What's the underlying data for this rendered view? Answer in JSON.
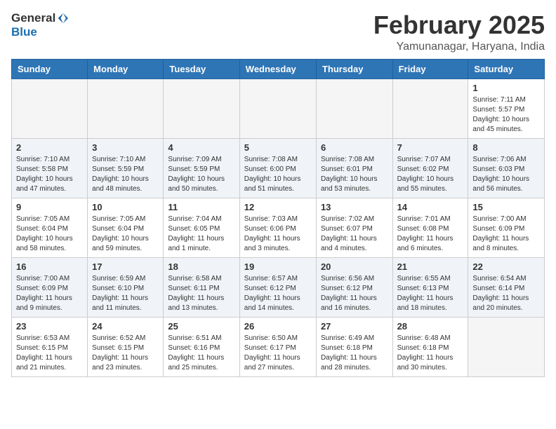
{
  "logo": {
    "general": "General",
    "blue": "Blue"
  },
  "title": "February 2025",
  "location": "Yamunanagar, Haryana, India",
  "headers": [
    "Sunday",
    "Monday",
    "Tuesday",
    "Wednesday",
    "Thursday",
    "Friday",
    "Saturday"
  ],
  "weeks": [
    [
      {
        "day": "",
        "info": ""
      },
      {
        "day": "",
        "info": ""
      },
      {
        "day": "",
        "info": ""
      },
      {
        "day": "",
        "info": ""
      },
      {
        "day": "",
        "info": ""
      },
      {
        "day": "",
        "info": ""
      },
      {
        "day": "1",
        "info": "Sunrise: 7:11 AM\nSunset: 5:57 PM\nDaylight: 10 hours and 45 minutes."
      }
    ],
    [
      {
        "day": "2",
        "info": "Sunrise: 7:10 AM\nSunset: 5:58 PM\nDaylight: 10 hours and 47 minutes."
      },
      {
        "day": "3",
        "info": "Sunrise: 7:10 AM\nSunset: 5:59 PM\nDaylight: 10 hours and 48 minutes."
      },
      {
        "day": "4",
        "info": "Sunrise: 7:09 AM\nSunset: 5:59 PM\nDaylight: 10 hours and 50 minutes."
      },
      {
        "day": "5",
        "info": "Sunrise: 7:08 AM\nSunset: 6:00 PM\nDaylight: 10 hours and 51 minutes."
      },
      {
        "day": "6",
        "info": "Sunrise: 7:08 AM\nSunset: 6:01 PM\nDaylight: 10 hours and 53 minutes."
      },
      {
        "day": "7",
        "info": "Sunrise: 7:07 AM\nSunset: 6:02 PM\nDaylight: 10 hours and 55 minutes."
      },
      {
        "day": "8",
        "info": "Sunrise: 7:06 AM\nSunset: 6:03 PM\nDaylight: 10 hours and 56 minutes."
      }
    ],
    [
      {
        "day": "9",
        "info": "Sunrise: 7:05 AM\nSunset: 6:04 PM\nDaylight: 10 hours and 58 minutes."
      },
      {
        "day": "10",
        "info": "Sunrise: 7:05 AM\nSunset: 6:04 PM\nDaylight: 10 hours and 59 minutes."
      },
      {
        "day": "11",
        "info": "Sunrise: 7:04 AM\nSunset: 6:05 PM\nDaylight: 11 hours and 1 minute."
      },
      {
        "day": "12",
        "info": "Sunrise: 7:03 AM\nSunset: 6:06 PM\nDaylight: 11 hours and 3 minutes."
      },
      {
        "day": "13",
        "info": "Sunrise: 7:02 AM\nSunset: 6:07 PM\nDaylight: 11 hours and 4 minutes."
      },
      {
        "day": "14",
        "info": "Sunrise: 7:01 AM\nSunset: 6:08 PM\nDaylight: 11 hours and 6 minutes."
      },
      {
        "day": "15",
        "info": "Sunrise: 7:00 AM\nSunset: 6:09 PM\nDaylight: 11 hours and 8 minutes."
      }
    ],
    [
      {
        "day": "16",
        "info": "Sunrise: 7:00 AM\nSunset: 6:09 PM\nDaylight: 11 hours and 9 minutes."
      },
      {
        "day": "17",
        "info": "Sunrise: 6:59 AM\nSunset: 6:10 PM\nDaylight: 11 hours and 11 minutes."
      },
      {
        "day": "18",
        "info": "Sunrise: 6:58 AM\nSunset: 6:11 PM\nDaylight: 11 hours and 13 minutes."
      },
      {
        "day": "19",
        "info": "Sunrise: 6:57 AM\nSunset: 6:12 PM\nDaylight: 11 hours and 14 minutes."
      },
      {
        "day": "20",
        "info": "Sunrise: 6:56 AM\nSunset: 6:12 PM\nDaylight: 11 hours and 16 minutes."
      },
      {
        "day": "21",
        "info": "Sunrise: 6:55 AM\nSunset: 6:13 PM\nDaylight: 11 hours and 18 minutes."
      },
      {
        "day": "22",
        "info": "Sunrise: 6:54 AM\nSunset: 6:14 PM\nDaylight: 11 hours and 20 minutes."
      }
    ],
    [
      {
        "day": "23",
        "info": "Sunrise: 6:53 AM\nSunset: 6:15 PM\nDaylight: 11 hours and 21 minutes."
      },
      {
        "day": "24",
        "info": "Sunrise: 6:52 AM\nSunset: 6:15 PM\nDaylight: 11 hours and 23 minutes."
      },
      {
        "day": "25",
        "info": "Sunrise: 6:51 AM\nSunset: 6:16 PM\nDaylight: 11 hours and 25 minutes."
      },
      {
        "day": "26",
        "info": "Sunrise: 6:50 AM\nSunset: 6:17 PM\nDaylight: 11 hours and 27 minutes."
      },
      {
        "day": "27",
        "info": "Sunrise: 6:49 AM\nSunset: 6:18 PM\nDaylight: 11 hours and 28 minutes."
      },
      {
        "day": "28",
        "info": "Sunrise: 6:48 AM\nSunset: 6:18 PM\nDaylight: 11 hours and 30 minutes."
      },
      {
        "day": "",
        "info": ""
      }
    ]
  ]
}
